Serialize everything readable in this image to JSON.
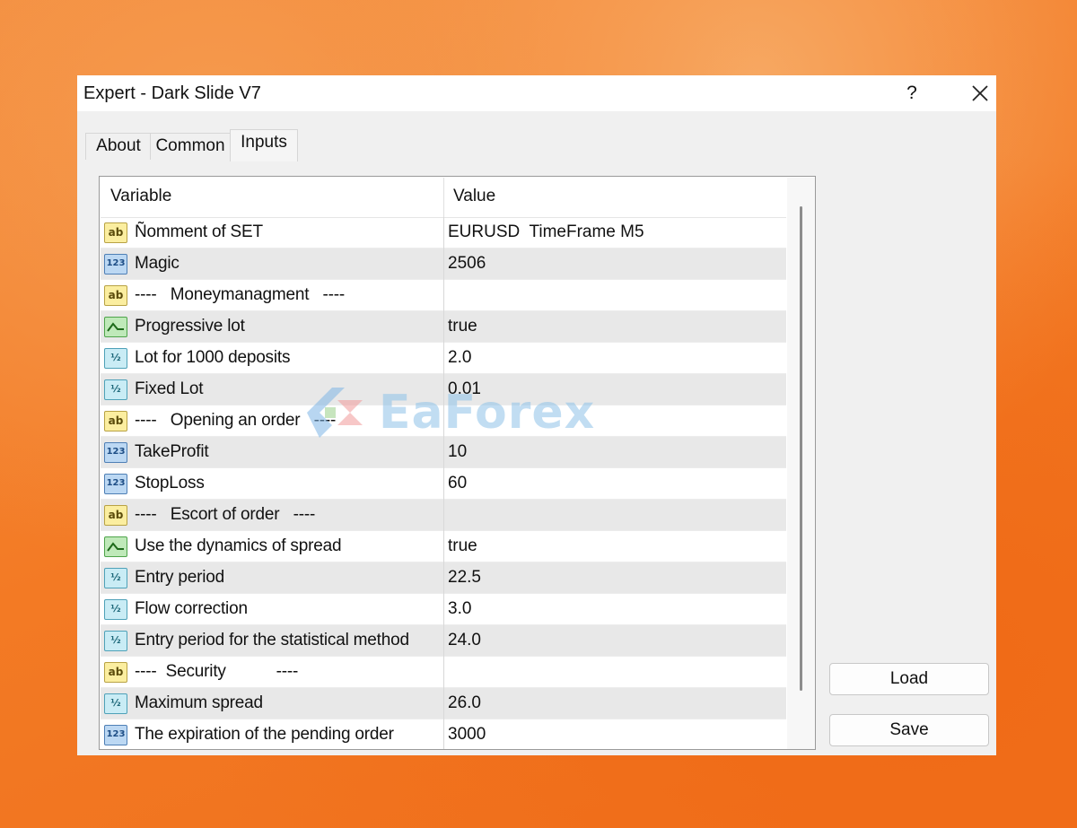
{
  "window": {
    "title": "Expert - Dark Slide V7",
    "help_label": "?"
  },
  "tabs": [
    {
      "label": "About",
      "active": false
    },
    {
      "label": "Common",
      "active": false
    },
    {
      "label": "Inputs",
      "active": true
    }
  ],
  "grid": {
    "columns": [
      "Variable",
      "Value"
    ],
    "rows": [
      {
        "icon": "string-icon",
        "variable": "Ñomment of SET",
        "value": "EURUSD  TimeFrame M5"
      },
      {
        "icon": "integer-icon",
        "variable": "Magic",
        "value": "2506"
      },
      {
        "icon": "string-icon",
        "variable": "----   Moneymanagment   ----",
        "value": ""
      },
      {
        "icon": "boolean-icon",
        "variable": "Progressive lot",
        "value": "true"
      },
      {
        "icon": "double-icon",
        "variable": "Lot for 1000 deposits",
        "value": "2.0"
      },
      {
        "icon": "double-icon",
        "variable": "Fixed Lot",
        "value": "0.01"
      },
      {
        "icon": "string-icon",
        "variable": "----   Opening an order   ----",
        "value": ""
      },
      {
        "icon": "integer-icon",
        "variable": "TakeProfit",
        "value": "10"
      },
      {
        "icon": "integer-icon",
        "variable": "StopLoss",
        "value": "60"
      },
      {
        "icon": "string-icon",
        "variable": "----   Escort of order   ----",
        "value": ""
      },
      {
        "icon": "boolean-icon",
        "variable": "Use the dynamics of spread",
        "value": "true"
      },
      {
        "icon": "double-icon",
        "variable": "Entry period",
        "value": "22.5"
      },
      {
        "icon": "double-icon",
        "variable": "Flow correction",
        "value": "3.0"
      },
      {
        "icon": "double-icon",
        "variable": "Entry period for the statistical method",
        "value": "24.0"
      },
      {
        "icon": "string-icon",
        "variable": "----  Security           ----",
        "value": ""
      },
      {
        "icon": "double-icon",
        "variable": "Maximum spread",
        "value": "26.0"
      },
      {
        "icon": "integer-icon",
        "variable": "The expiration of the pending order",
        "value": "3000"
      }
    ]
  },
  "icon_labels": {
    "string": "ab",
    "integer": "123",
    "double": "½"
  },
  "buttons": {
    "load": "Load",
    "save": "Save"
  },
  "watermark": {
    "text": "EaForex"
  },
  "colors": {
    "background": "#f37a24",
    "dialog": "#f0f0f0",
    "alt_row": "#e8e8e8"
  }
}
